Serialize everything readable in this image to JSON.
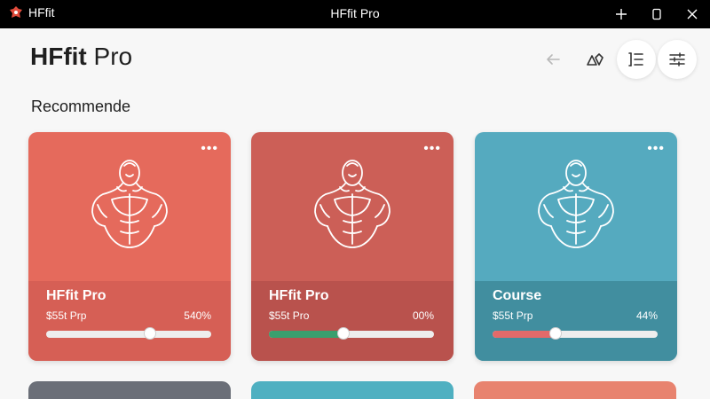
{
  "titlebar": {
    "app_name": "HFfit",
    "window_title": "HFfit Pro"
  },
  "header": {
    "title_bold": "HFfit",
    "title_light": " Pro",
    "icons": [
      "back-arrow-icon",
      "shapes-icon",
      "list-icon",
      "filter-icon"
    ]
  },
  "section": {
    "title": "Recommende"
  },
  "cards": [
    {
      "title": "HFfit Pro",
      "subtitle": "$55t Prp",
      "percent_text": "540%",
      "progress": 0.63,
      "bg": "#e56a5c",
      "band": "#d65f55",
      "fill": ""
    },
    {
      "title": "HFfit Pro",
      "subtitle": "$55t Pro",
      "percent_text": "00%",
      "progress": 0.45,
      "bg": "#cc5f57",
      "band": "#b9524d",
      "fill": "#3a9f6e"
    },
    {
      "title": "Course",
      "subtitle": "$55t Prp",
      "percent_text": "44%",
      "progress": 0.38,
      "bg": "#55aabf",
      "band": "#418e9f",
      "fill": "#e36a6a"
    }
  ],
  "peek_colors": [
    "#6b6f78",
    "#4fb0c1",
    "#e8836f"
  ]
}
